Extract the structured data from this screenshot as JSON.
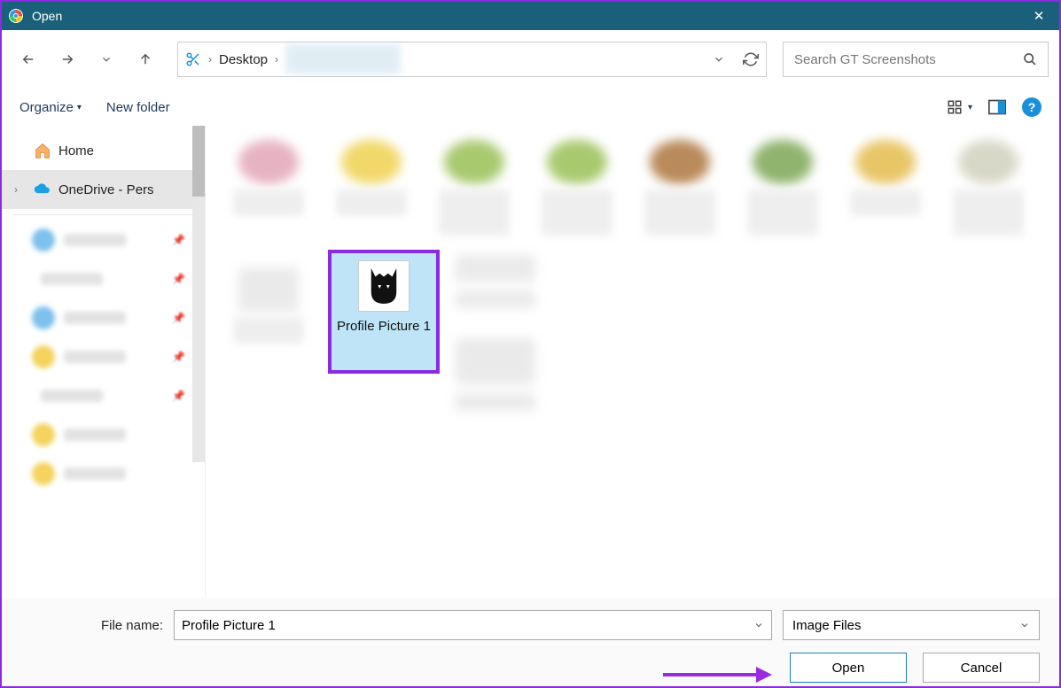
{
  "titlebar": {
    "title": "Open"
  },
  "nav": {
    "breadcrumb": [
      "Desktop"
    ]
  },
  "search": {
    "placeholder": "Search GT Screenshots"
  },
  "toolbar": {
    "organize": "Organize",
    "new_folder": "New folder"
  },
  "sidebar": {
    "home": "Home",
    "onedrive": "OneDrive - Pers"
  },
  "selected_file": {
    "name": "Profile Picture 1"
  },
  "footer": {
    "filename_label": "File name:",
    "filename_value": "Profile Picture 1",
    "filetype_value": "Image Files",
    "open": "Open",
    "cancel": "Cancel"
  }
}
